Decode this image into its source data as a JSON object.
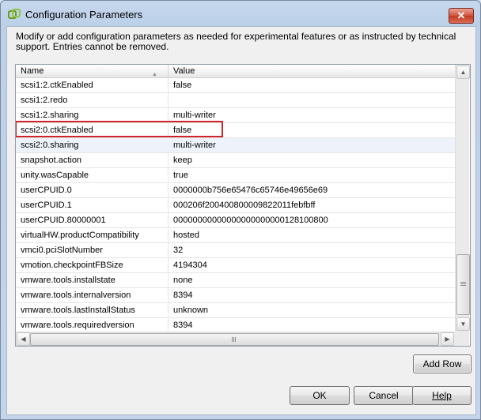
{
  "window": {
    "title": "Configuration Parameters",
    "close_label": "✕"
  },
  "description": "Modify or add configuration parameters as needed for experimental features or as instructed by technical support. Entries cannot be removed.",
  "grid": {
    "columns": {
      "name": "Name",
      "value": "Value"
    },
    "rows": [
      {
        "name": "scsi1:2.ctkEnabled",
        "value": "false"
      },
      {
        "name": "scsi1:2.redo",
        "value": ""
      },
      {
        "name": "scsi1:2.sharing",
        "value": "multi-writer"
      },
      {
        "name": "scsi2:0.ctkEnabled",
        "value": "false"
      },
      {
        "name": "scsi2:0.sharing",
        "value": "multi-writer"
      },
      {
        "name": "snapshot.action",
        "value": "keep"
      },
      {
        "name": "unity.wasCapable",
        "value": "true"
      },
      {
        "name": "userCPUID.0",
        "value": "0000000b756e65476c65746e49656e69"
      },
      {
        "name": "userCPUID.1",
        "value": "000206f200400800009822011febfbff"
      },
      {
        "name": "userCPUID.80000001",
        "value": "00000000000000000000000128100800"
      },
      {
        "name": "virtualHW.productCompatibility",
        "value": "hosted"
      },
      {
        "name": "vmci0.pciSlotNumber",
        "value": "32"
      },
      {
        "name": "vmotion.checkpointFBSize",
        "value": "4194304"
      },
      {
        "name": "vmware.tools.installstate",
        "value": "none"
      },
      {
        "name": "vmware.tools.internalversion",
        "value": "8394"
      },
      {
        "name": "vmware.tools.lastInstallStatus",
        "value": "unknown"
      },
      {
        "name": "vmware.tools.requiredversion",
        "value": "8394"
      }
    ]
  },
  "buttons": {
    "add_row": "Add Row",
    "ok": "OK",
    "cancel": "Cancel",
    "help": "Help"
  },
  "colors": {
    "highlight_border": "#d2232a",
    "title_bar": "#c6d8ee",
    "close_button": "#c43a22"
  }
}
